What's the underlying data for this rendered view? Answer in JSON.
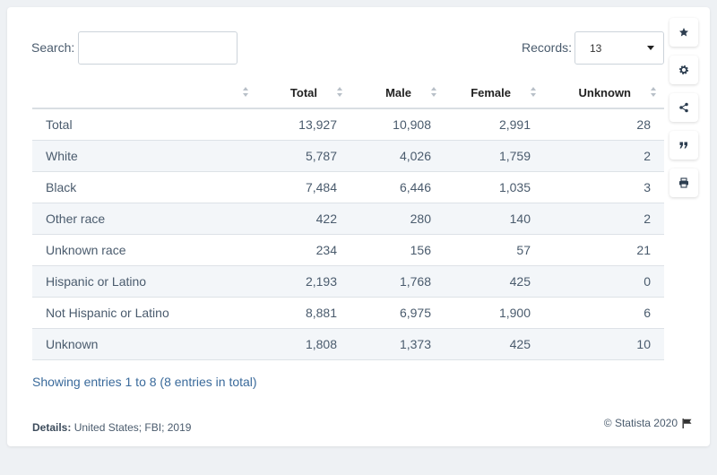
{
  "controls": {
    "search_label": "Search:",
    "search_value": "",
    "records_label": "Records:",
    "records_value": "13"
  },
  "table": {
    "columns": [
      "",
      "Total",
      "Male",
      "Female",
      "Unknown"
    ],
    "rows": [
      [
        "Total",
        "13,927",
        "10,908",
        "2,991",
        "28"
      ],
      [
        "White",
        "5,787",
        "4,026",
        "1,759",
        "2"
      ],
      [
        "Black",
        "7,484",
        "6,446",
        "1,035",
        "3"
      ],
      [
        "Other race",
        "422",
        "280",
        "140",
        "2"
      ],
      [
        "Unknown race",
        "234",
        "156",
        "57",
        "21"
      ],
      [
        "Hispanic or Latino",
        "2,193",
        "1,768",
        "425",
        "0"
      ],
      [
        "Not Hispanic or Latino",
        "8,881",
        "6,975",
        "1,900",
        "6"
      ],
      [
        "Unknown",
        "1,808",
        "1,373",
        "425",
        "10"
      ]
    ]
  },
  "footer": {
    "showing": "Showing entries 1 to 8 (8 entries in total)",
    "details_label": "Details:",
    "details_text": "United States; FBI; 2019",
    "copyright": "© Statista 2020"
  },
  "sidebar": {
    "buttons": [
      "star-icon",
      "gear-icon",
      "share-icon",
      "quote-icon",
      "print-icon"
    ]
  },
  "colors": {
    "accent": "#3a6a9b",
    "icon": "#2d3e50",
    "row_alt": "#f3f6f9"
  }
}
